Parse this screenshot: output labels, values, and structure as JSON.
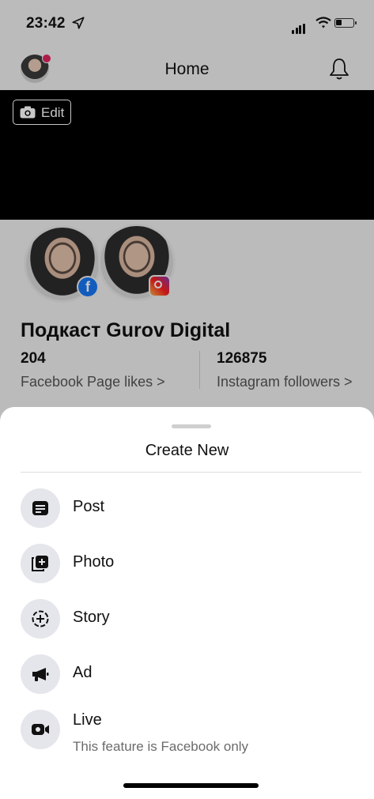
{
  "status_bar": {
    "time": "23:42"
  },
  "nav": {
    "title": "Home"
  },
  "cover": {
    "edit_label": "Edit"
  },
  "profile": {
    "page_name": "Подкаст Gurov Digital",
    "stats": [
      {
        "value": "204",
        "label": "Facebook Page likes >"
      },
      {
        "value": "126875",
        "label": "Instagram followers >"
      }
    ],
    "badges": {
      "facebook": "f"
    }
  },
  "sheet": {
    "title": "Create New",
    "items": [
      {
        "label": "Post",
        "icon": "post-icon"
      },
      {
        "label": "Photo",
        "icon": "photo-icon"
      },
      {
        "label": "Story",
        "icon": "story-icon"
      },
      {
        "label": "Ad",
        "icon": "megaphone-icon"
      },
      {
        "label": "Live",
        "icon": "live-video-icon",
        "sublabel": "This feature is Facebook only"
      }
    ]
  },
  "colors": {
    "facebook_blue": "#1877f2",
    "notification_red": "#e0245e",
    "icon_bg": "#e4e6eb"
  }
}
